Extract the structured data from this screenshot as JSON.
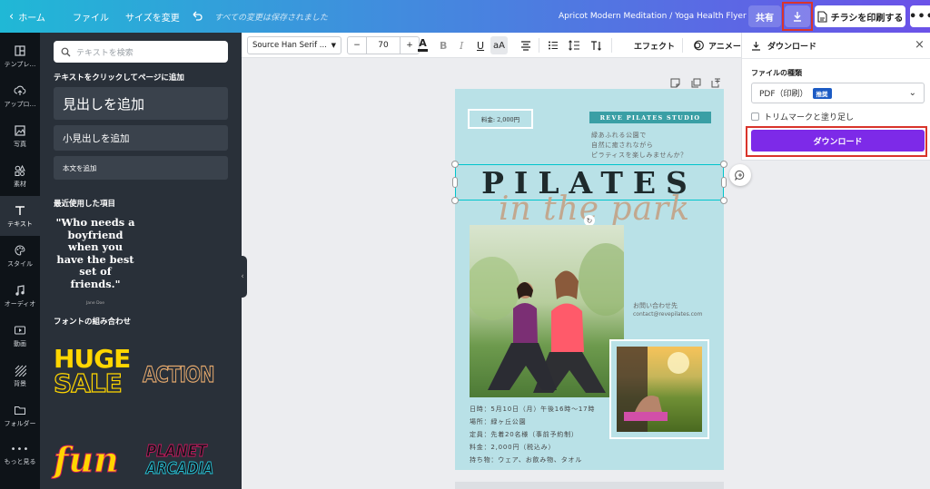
{
  "topbar": {
    "home": "ホーム",
    "file": "ファイル",
    "resize": "サイズを変更",
    "saved_status": "すべての変更は保存されました",
    "doc_title": "Apricot Modern Meditation / Yoga Health Flyer",
    "share": "共有",
    "print": "チラシを印刷する"
  },
  "rail": [
    {
      "label": "テンプレ…"
    },
    {
      "label": "アップロ…"
    },
    {
      "label": "写真"
    },
    {
      "label": "素材"
    },
    {
      "label": "テキスト"
    },
    {
      "label": "スタイル"
    },
    {
      "label": "オーディオ"
    },
    {
      "label": "動画"
    },
    {
      "label": "背景"
    },
    {
      "label": "フォルダー"
    },
    {
      "label": "もっと見る"
    }
  ],
  "panel": {
    "search_placeholder": "テキストを検索",
    "click_to_add": "テキストをクリックしてページに追加",
    "add_heading": "見出しを追加",
    "add_subheading": "小見出しを追加",
    "add_body": "本文を追加",
    "recent_header": "最近使用した項目",
    "recent_quote": "\"Who needs a boyfriend when you have the best set of friends.\"",
    "recent_author": "Jane Doe",
    "combos_header": "フォントの組み合わせ",
    "combo1_line1": "HUGE",
    "combo1_line2": "SALE",
    "combo2": "ACTION",
    "combo3": "fun",
    "combo4_line1": "PLANET",
    "combo4_line2": "ARCADIA"
  },
  "toolbar": {
    "font": "Source Han Serif ...",
    "minus": "−",
    "size": "70",
    "plus": "+",
    "effects": "エフェクト",
    "animate": "アニメー"
  },
  "flyer": {
    "price": "料金: 2,000円",
    "studio": "REVE PILATES STUDIO",
    "tagline1": "緑あふれる公園で",
    "tagline2": "自然に癒されながら",
    "tagline3": "ピラティスを楽しみませんか？",
    "title": "PILATES",
    "script": "in the park",
    "contact_label": "お問い合わせ先",
    "contact_email": "contact@revepilates.com",
    "details": [
      "日時：5月10日（月）午後16時〜17時",
      "場所：緑ヶ丘公園",
      "定員：先着20名様（事前予約制）",
      "料金：2,000円（税込み）",
      "持ち物：ウェア、お飲み物、タオル"
    ]
  },
  "download": {
    "title": "ダウンロード",
    "file_type_label": "ファイルの種類",
    "file_type_value": "PDF（印刷）",
    "badge": "推奨",
    "crop_marks": "トリムマークと塗り足し",
    "button": "ダウンロード"
  },
  "colors": {
    "accent": "#7d2ae8",
    "flyer_bg": "#b9e1e7",
    "studio_bar": "#3a9fa5",
    "highlight": "#d9342b"
  }
}
